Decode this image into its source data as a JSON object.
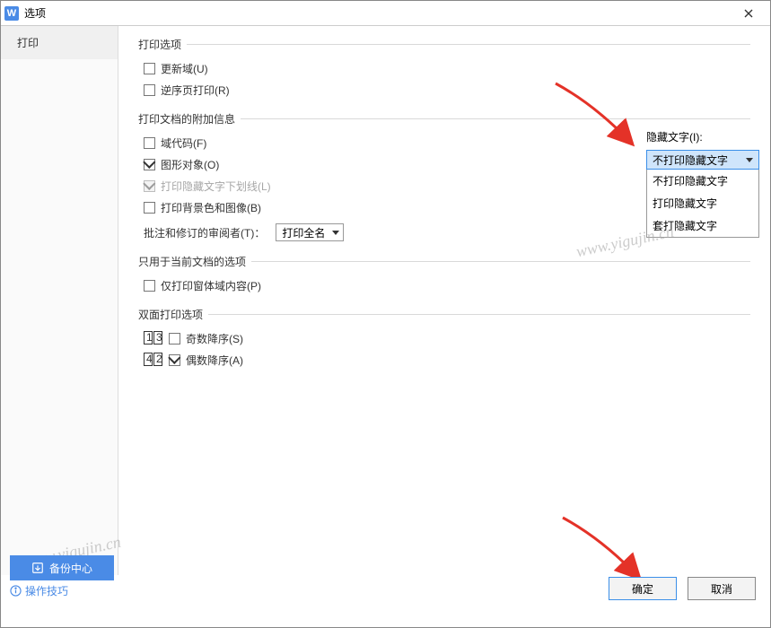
{
  "window": {
    "title": "选项"
  },
  "sidebar": {
    "items": [
      {
        "label": "打印"
      }
    ]
  },
  "groups": {
    "print_options": {
      "legend": "打印选项",
      "update_fields": "更新域(U)",
      "reverse_order": "逆序页打印(R)"
    },
    "doc_additional_info": {
      "legend": "打印文档的附加信息",
      "field_codes": "域代码(F)",
      "drawings": "图形对象(O)",
      "hidden_underline": "打印隐藏文字下划线(L)",
      "background": "打印背景色和图像(B)",
      "reviewer_label": "批注和修订的审阅者(T)：",
      "reviewer_value": "打印全名"
    },
    "current_doc": {
      "legend": "只用于当前文档的选项",
      "form_fields_only": "仅打印窗体域内容(P)"
    },
    "duplex": {
      "legend": "双面打印选项",
      "odd_desc": "奇数降序(S)",
      "even_desc": "偶数降序(A)"
    }
  },
  "hidden_text": {
    "label": "隐藏文字(I):",
    "selected": "不打印隐藏文字",
    "options": [
      "不打印隐藏文字",
      "打印隐藏文字",
      "套打隐藏文字"
    ]
  },
  "footer": {
    "backup_center": "备份中心",
    "tips": "操作技巧",
    "ok": "确定",
    "cancel": "取消"
  },
  "watermark": "www.yigujin.cn"
}
